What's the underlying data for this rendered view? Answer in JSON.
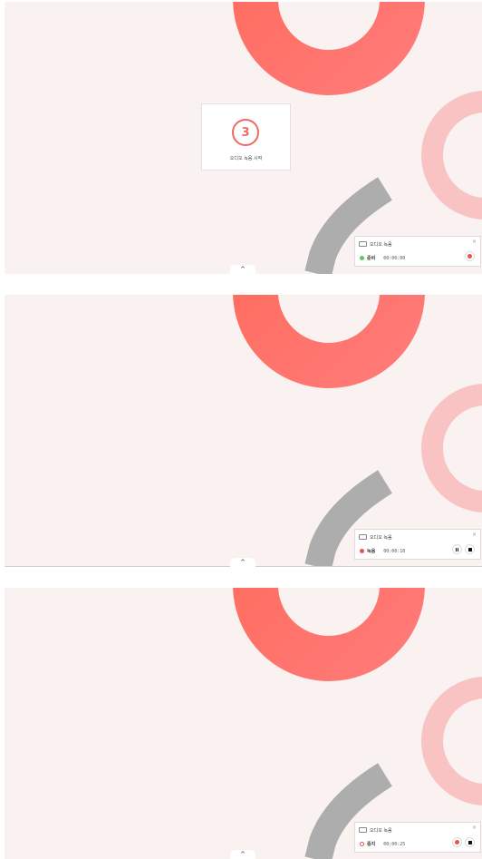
{
  "colors": {
    "background": "#f9f2f1",
    "ring_red": "#ff6a55",
    "ring_pink": "#f8c3c2",
    "arc_gray": "#adadad",
    "accent_red": "#e9534c",
    "ready_green": "#5cc66a"
  },
  "screen1": {
    "countdown": {
      "number": "3",
      "label": "오디오 녹음 시작"
    },
    "recorder": {
      "title": "오디오 녹음",
      "close_label": "×",
      "status": "준비",
      "time": "00:00:00",
      "status_dot_icon": "green-dot-icon"
    },
    "collapse_label": "^"
  },
  "screen2": {
    "recorder": {
      "title": "오디오 녹음",
      "close_label": "×",
      "status": "녹음",
      "time": "00:00:10",
      "status_dot_icon": "red-dot-icon"
    },
    "collapse_label": "^"
  },
  "screen3": {
    "recorder": {
      "title": "오디오 녹음",
      "close_label": "×",
      "status": "중지",
      "time": "00:00:25",
      "status_dot_icon": "hollow-red-dot-icon"
    },
    "collapse_label": "^"
  }
}
